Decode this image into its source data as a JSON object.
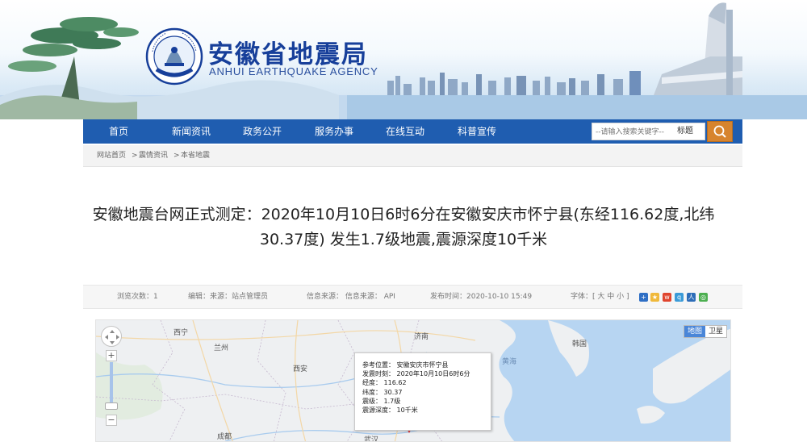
{
  "header": {
    "title": "安徽省地震局",
    "subtitle": "ANHUI EARTHQUAKE AGENCY",
    "emblem_text_top": "CHINA EARTHQUAKE ADMINISTRATION",
    "emblem_text_bottom": "中国地震局"
  },
  "nav": {
    "items": [
      "首页",
      "新闻资讯",
      "政务公开",
      "服务办事",
      "在线互动",
      "科普宣传"
    ],
    "search_placeholder": "--请输入搜索关键字--",
    "search_type": "标题",
    "search_icon": "magnifier-icon"
  },
  "breadcrumb": [
    "网站首页",
    ">",
    "震情资讯",
    ">",
    "本省地震"
  ],
  "article": {
    "title": "安徽地震台网正式测定：2020年10月10日6时6分在安徽安庆市怀宁县(东经116.62度,北纬30.37度) 发生1.7级地震,震源深度10千米"
  },
  "meta": {
    "views": "浏览次数：1",
    "editor": "编辑：来源：站点管理员",
    "source": "信息来源：  信息来源： API",
    "published": "发布时间：2020-10-10 15:49",
    "font_size": "字体：[ 大 中 小 ]",
    "share_icons": [
      "qzone-icon",
      "star-icon",
      "weibo-icon",
      "qq-weibo-icon",
      "renren-icon",
      "wechat-icon"
    ]
  },
  "map": {
    "type_buttons": [
      "地图",
      "卫星"
    ],
    "labels": {
      "xining": "西宁",
      "lanzhou": "兰州",
      "xian": "西安",
      "jinan": "济南",
      "korea": "韩国",
      "yellow_sea": "黄海",
      "chengdu": "成都",
      "wuhan": "武汉"
    },
    "info": {
      "location": "参考位置：  安徽安庆市怀宁县",
      "time": "发震时刻：  2020年10月10日6时6分",
      "longitude": "经度：  116.62",
      "latitude": "纬度：  30.37",
      "magnitude": "震级：  1.7级",
      "depth": "震源深度：  10千米"
    }
  },
  "colors": {
    "nav_bg": "#1f5db0",
    "title_blue": "#173f9a",
    "search_btn": "#d7842e"
  }
}
